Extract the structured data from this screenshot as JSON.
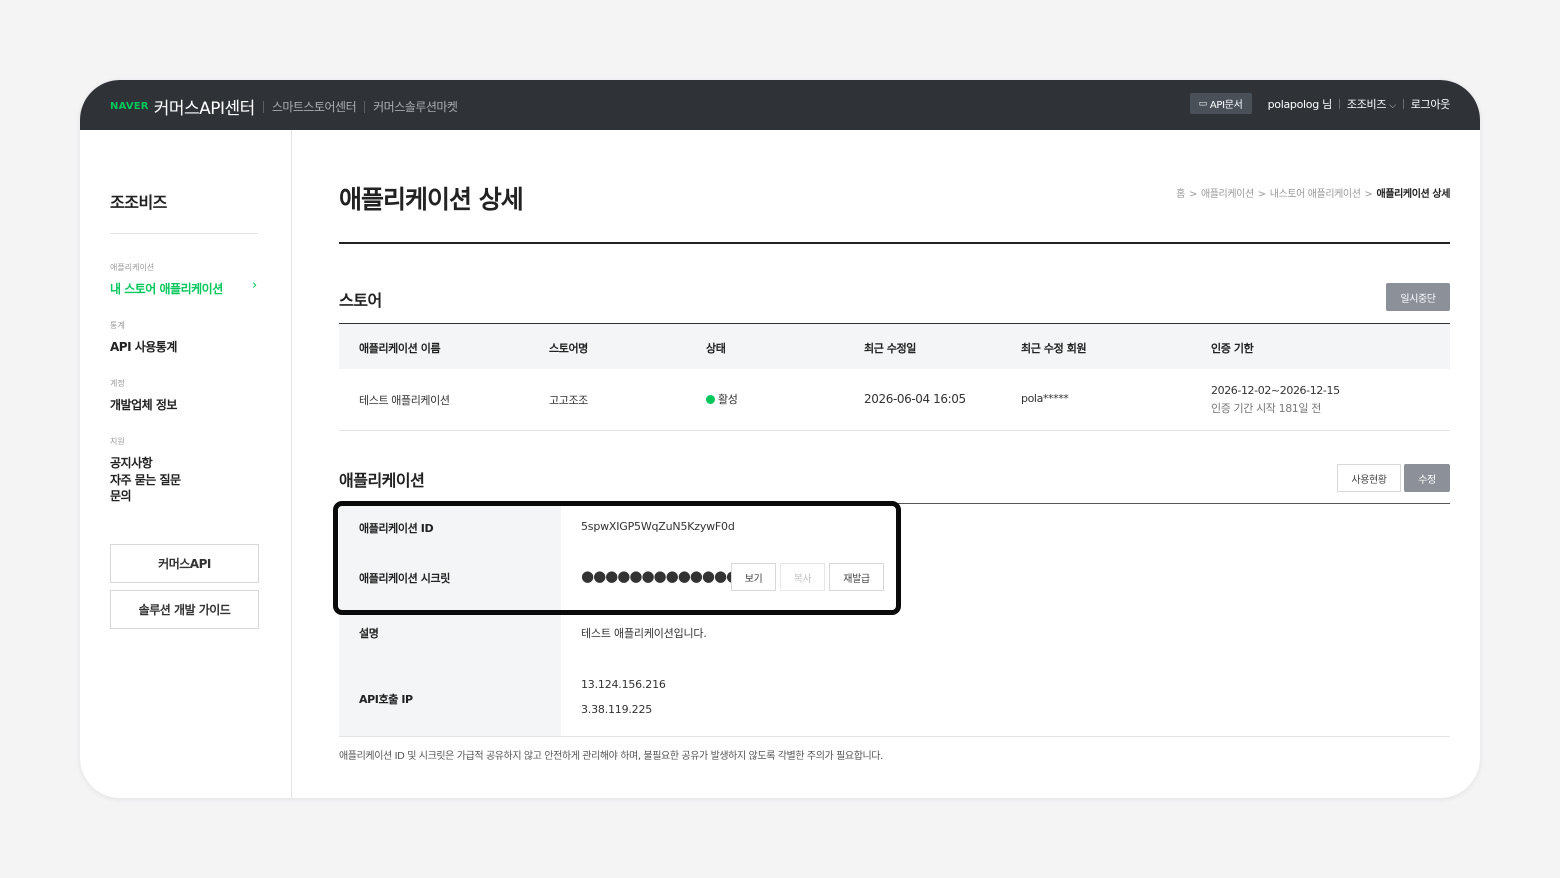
{
  "header": {
    "naver_logo": "NAVER",
    "center_title": "커머스API센터",
    "nav_links": [
      "스마트스토어센터",
      "커머스솔루션마켓"
    ],
    "api_doc_label": "API문서",
    "api_doc_icon": "monitor-icon",
    "user_label": "polapolog 님",
    "account_label": "조조비즈",
    "logout_label": "로그아웃"
  },
  "sidebar": {
    "title": "조조비즈",
    "sections": [
      {
        "label": "애플리케이션",
        "items": [
          "내 스토어 애플리케이션"
        ]
      },
      {
        "label": "통계",
        "items": [
          "API 사용통계"
        ]
      },
      {
        "label": "계정",
        "items": [
          "개발업체 정보"
        ]
      },
      {
        "label": "지원",
        "items": [
          "공지사항",
          "자주 묻는 질문",
          "문의"
        ]
      }
    ],
    "buttons": [
      "커머스API",
      "솔루션 개발 가이드"
    ]
  },
  "page": {
    "title": "애플리케이션 상세",
    "breadcrumbs": [
      "홈",
      "애플리케이션",
      "내스토어 애플리케이션",
      "애플리케이션 상세"
    ]
  },
  "store": {
    "section_title": "스토어",
    "pause_button": "일시중단",
    "columns": [
      "애플리케이션 이름",
      "스토어명",
      "상태",
      "최근 수정일",
      "최근 수정 회원",
      "인증 기한"
    ],
    "row": {
      "app_name": "테스트 애플리케이션",
      "store_name": "고고조조",
      "status": "활성",
      "modified_date": "2026-06-04 16:05",
      "modified_by": "pola*****",
      "auth_period": "2026-12-02~2026-12-15",
      "auth_note": "인증 기간 시작 181일 전"
    }
  },
  "application": {
    "section_title": "애플리케이션",
    "usage_button": "사용현황",
    "edit_button": "수정",
    "fields": {
      "id_label": "애플리케이션 ID",
      "id_value": "5spwXIGP5WqZuN5KzywF0d",
      "secret_label": "애플리케이션 시크릿",
      "secret_value": "●●●●●●●●●●●●●",
      "view_button": "보기",
      "copy_button": "복사",
      "reissue_button": "재발급",
      "desc_label": "설명",
      "desc_value": "테스트 애플리케이션입니다.",
      "ip_label": "API호출 IP",
      "ip_values": [
        "13.124.156.216",
        "3.38.119.225"
      ]
    },
    "note": "애플리케이션 ID 및 시크릿은 가급적 공유하지 않고 안전하게 관리해야 하며, 불필요한 공유가 발생하지 않도록 각별한 주의가 필요합니다."
  },
  "colors": {
    "accent_green": "#03c75a",
    "header_bg": "#2f3338",
    "highlight_border": "#0a0a0a"
  }
}
